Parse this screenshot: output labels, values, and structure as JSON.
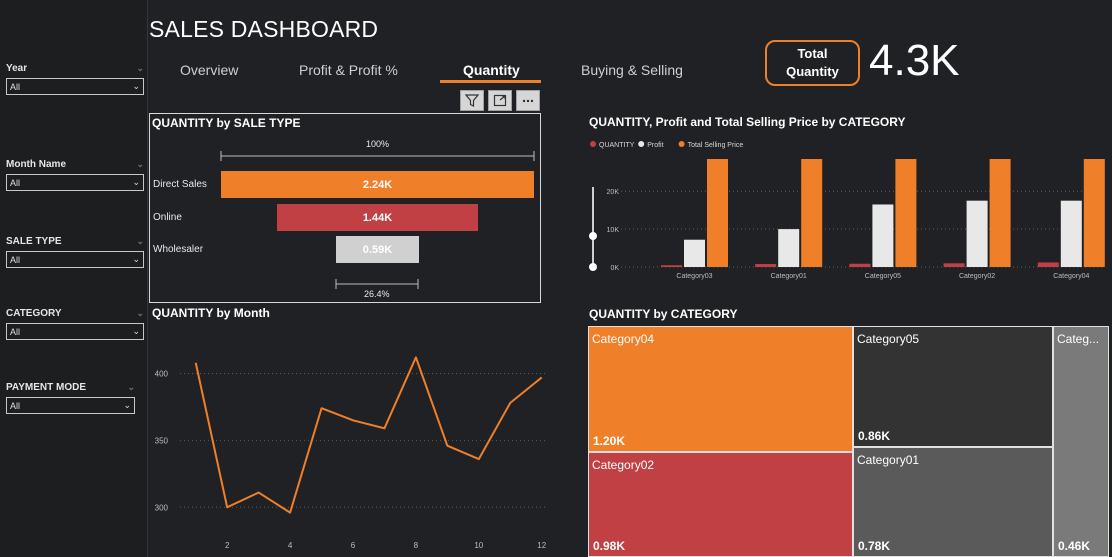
{
  "sidebar": {
    "slicers": [
      {
        "label": "Year",
        "value": "All"
      },
      {
        "label": "Month Name",
        "value": "All"
      },
      {
        "label": "SALE TYPE",
        "value": "All"
      },
      {
        "label": "CATEGORY",
        "value": "All"
      },
      {
        "label": "PAYMENT MODE",
        "value": "All"
      }
    ]
  },
  "header": {
    "title": "SALES DASHBOARD",
    "tabs": [
      {
        "label": "Overview"
      },
      {
        "label": "Profit & Profit %"
      },
      {
        "label": "Quantity"
      },
      {
        "label": "Buying & Selling"
      }
    ],
    "active_tab": "Quantity",
    "kpi": {
      "label_line1": "Total",
      "label_line2": "Quantity",
      "value": "4.3K"
    }
  },
  "icons": [
    "filter-icon",
    "focus-mode-icon",
    "more-options-icon"
  ],
  "colors": {
    "orange": "#f07f2a",
    "red": "#c04044",
    "white": "#e8e8e8",
    "grey": "#404040"
  },
  "funnel": {
    "title": "QUANTITY by SALE TYPE",
    "top_percent": "100%",
    "bottom_percent": "26.4%",
    "rows": [
      {
        "label": "Direct Sales",
        "value": "2.24K",
        "quantity": 2240,
        "color": "#f07f2a"
      },
      {
        "label": "Online",
        "value": "1.44K",
        "quantity": 1440,
        "color": "#c04044"
      },
      {
        "label": "Wholesaler",
        "value": "0.59K",
        "quantity": 590,
        "color": "#d0d0d0"
      }
    ]
  },
  "treemap": {
    "title": "QUANTITY by CATEGORY",
    "items": [
      {
        "label": "Category04",
        "value": "1.20K",
        "color": "#f07f2a"
      },
      {
        "label": "Category02",
        "value": "0.98K",
        "color": "#c04044"
      },
      {
        "label": "Category05",
        "value": "0.86K",
        "color": "#333333"
      },
      {
        "label": "Category01",
        "value": "0.78K",
        "color": "#5a5a5a"
      },
      {
        "label": "Categ...",
        "value": "0.46K",
        "color": "#7a7a7a"
      }
    ]
  },
  "chart_data": [
    {
      "type": "line",
      "title": "QUANTITY by Month",
      "x": [
        1,
        2,
        3,
        4,
        5,
        6,
        7,
        8,
        9,
        10,
        11,
        12
      ],
      "y": [
        408,
        300,
        311,
        296,
        374,
        365,
        359,
        412,
        346,
        336,
        378,
        397
      ],
      "x_ticks": [
        "2",
        "4",
        "6",
        "8",
        "10",
        "12"
      ],
      "y_ticks": [
        "300",
        "350",
        "400"
      ],
      "ylim": [
        283,
        425
      ],
      "xlim": [
        0.5,
        12.2
      ],
      "grid": true,
      "color": "#f07f2a"
    },
    {
      "type": "bar",
      "title": "QUANTITY, Profit and Total Selling Price by CATEGORY",
      "categories": [
        "Category03",
        "Category01",
        "Category05",
        "Category02",
        "Category04"
      ],
      "series": [
        {
          "name": "QUANTITY",
          "color": "#c04044",
          "values": [
            460,
            780,
            860,
            980,
            1200
          ]
        },
        {
          "name": "Profit",
          "color": "#e8e8e8",
          "values": [
            7200,
            10000,
            16500,
            17500,
            17500
          ]
        },
        {
          "name": "Total Selling Price",
          "color": "#f07f2a",
          "values": [
            28500,
            28500,
            28500,
            28500,
            28500
          ]
        }
      ],
      "y_ticks": [
        "0K",
        "10K",
        "20K"
      ],
      "ylim": [
        0,
        28500
      ],
      "grid": true,
      "legend": "top-left"
    }
  ]
}
